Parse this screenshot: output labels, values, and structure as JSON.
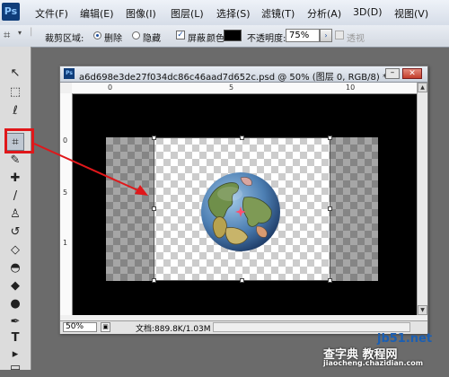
{
  "app": {
    "logo": "Ps"
  },
  "menu": [
    "文件(F)",
    "编辑(E)",
    "图像(I)",
    "图层(L)",
    "选择(S)",
    "滤镜(T)",
    "分析(A)",
    "3D(D)",
    "视图(V)"
  ],
  "options": {
    "crop_area_label": "裁剪区域:",
    "delete_label": "删除",
    "hide_label": "隐藏",
    "shield_label": "屏蔽",
    "color_label": "颜色:",
    "opacity_label": "不透明度:",
    "opacity_value": "75%",
    "perspective_label": "透视",
    "shield_color": "#000000"
  },
  "tools": [
    {
      "name": "move-tool",
      "glyph": "↖",
      "icon": "move-icon"
    },
    {
      "name": "marquee-tool",
      "glyph": "⬚",
      "icon": "marquee-icon"
    },
    {
      "name": "lasso-tool",
      "glyph": "ℓ",
      "icon": "lasso-icon"
    },
    {
      "name": "crop-tool",
      "glyph": "⌗",
      "icon": "crop-icon"
    },
    {
      "name": "eyedropper-tool",
      "glyph": "✎",
      "icon": "eyedropper-icon"
    },
    {
      "name": "healing-tool",
      "glyph": "✚",
      "icon": "healing-brush-icon"
    },
    {
      "name": "brush-tool",
      "glyph": "/",
      "icon": "brush-icon"
    },
    {
      "name": "stamp-tool",
      "glyph": "♙",
      "icon": "clone-stamp-icon"
    },
    {
      "name": "history-brush-tool",
      "glyph": "↺",
      "icon": "history-brush-icon"
    },
    {
      "name": "eraser-tool",
      "glyph": "◇",
      "icon": "eraser-icon"
    },
    {
      "name": "bucket-tool",
      "glyph": "◓",
      "icon": "paint-bucket-icon"
    },
    {
      "name": "blur-tool",
      "glyph": "◆",
      "icon": "blur-icon"
    },
    {
      "name": "dodge-tool",
      "glyph": "●",
      "icon": "dodge-icon"
    },
    {
      "name": "pen-tool",
      "glyph": "✒",
      "icon": "pen-icon"
    },
    {
      "name": "type-tool",
      "glyph": "T",
      "icon": "type-icon"
    },
    {
      "name": "path-select-tool",
      "glyph": "▸",
      "icon": "path-selection-icon"
    },
    {
      "name": "shape-tool",
      "glyph": "▭",
      "icon": "rectangle-shape-icon"
    }
  ],
  "document": {
    "title": "a6d698e3de27f034dc86c46aad7d652c.psd @ 50% (图层 0, RGB/8) *",
    "zoom": "50%",
    "doc_info": "文档:889.8K/1.03M",
    "ruler_top": [
      "0",
      "5",
      "10"
    ],
    "ruler_left": [
      "0",
      "5",
      "1"
    ]
  },
  "watermark": {
    "line1": "jb51.net",
    "line2": "查字典 教程网",
    "line3": "jiaocheng.chazidian.com"
  }
}
